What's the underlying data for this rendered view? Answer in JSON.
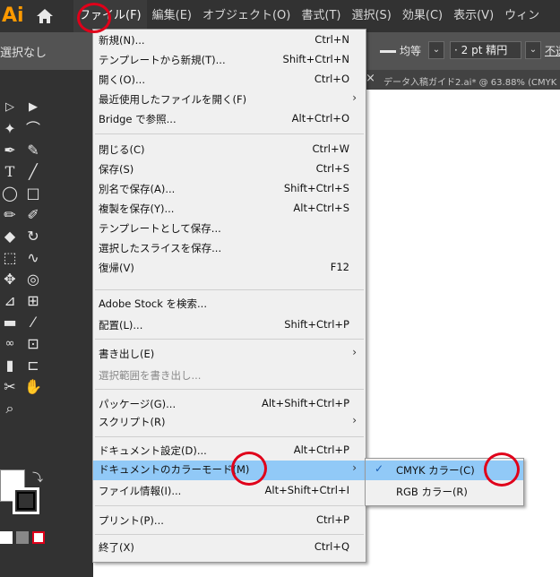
{
  "app": {
    "logo_text": "Ai",
    "logo_color": "#ff9a00"
  },
  "menubar": {
    "items": [
      {
        "label": "ファイル(F)",
        "active": true
      },
      {
        "label": "編集(E)"
      },
      {
        "label": "オブジェクト(O)"
      },
      {
        "label": "書式(T)"
      },
      {
        "label": "選択(S)"
      },
      {
        "label": "効果(C)"
      },
      {
        "label": "表示(V)"
      },
      {
        "label": "ウィン"
      }
    ]
  },
  "controlbar": {
    "selection_label": "選択なし",
    "profile_label": "均等",
    "brush_value": "· 2 pt 精円",
    "opacity_label": "不透"
  },
  "document_tab": {
    "close": "×",
    "title": "データ入稿ガイド2.ai* @ 63.88% (CMYK"
  },
  "file_menu": {
    "items": [
      {
        "label": "新規(N)...",
        "shortcut": "Ctrl+N"
      },
      {
        "label": "テンプレートから新規(T)...",
        "shortcut": "Shift+Ctrl+N"
      },
      {
        "label": "開く(O)...",
        "shortcut": "Ctrl+O"
      },
      {
        "label": "最近使用したファイルを開く(F)",
        "submenu": true
      },
      {
        "label": "Bridge で参照...",
        "shortcut": "Alt+Ctrl+O"
      },
      {
        "label": "閉じる(C)",
        "shortcut": "Ctrl+W"
      },
      {
        "label": "保存(S)",
        "shortcut": "Ctrl+S"
      },
      {
        "label": "別名で保存(A)...",
        "shortcut": "Shift+Ctrl+S"
      },
      {
        "label": "複製を保存(Y)...",
        "shortcut": "Alt+Ctrl+S"
      },
      {
        "label": "テンプレートとして保存..."
      },
      {
        "label": "選択したスライスを保存..."
      },
      {
        "label": "復帰(V)",
        "shortcut": "F12"
      },
      {
        "label": "Adobe Stock を検索..."
      },
      {
        "label": "配置(L)...",
        "shortcut": "Shift+Ctrl+P"
      },
      {
        "label": "書き出し(E)",
        "submenu": true
      },
      {
        "label": "選択範囲を書き出し...",
        "disabled": true
      },
      {
        "label": "パッケージ(G)...",
        "shortcut": "Alt+Shift+Ctrl+P"
      },
      {
        "label": "スクリプト(R)",
        "submenu": true
      },
      {
        "label": "ドキュメント設定(D)...",
        "shortcut": "Alt+Ctrl+P"
      },
      {
        "label": "ドキュメントのカラーモード(M)",
        "submenu": true,
        "highlighted": true
      },
      {
        "label": "ファイル情報(I)...",
        "shortcut": "Alt+Shift+Ctrl+I"
      },
      {
        "label": "プリント(P)...",
        "shortcut": "Ctrl+P"
      },
      {
        "label": "終了(X)",
        "shortcut": "Ctrl+Q"
      }
    ]
  },
  "color_mode_submenu": {
    "items": [
      {
        "label": "CMYK カラー(C)",
        "checked": true,
        "highlighted": true
      },
      {
        "label": "RGB カラー(R)",
        "checked": false
      }
    ]
  },
  "colors": {
    "highlight": "#91c9f7",
    "annotation": "#e0001a"
  }
}
